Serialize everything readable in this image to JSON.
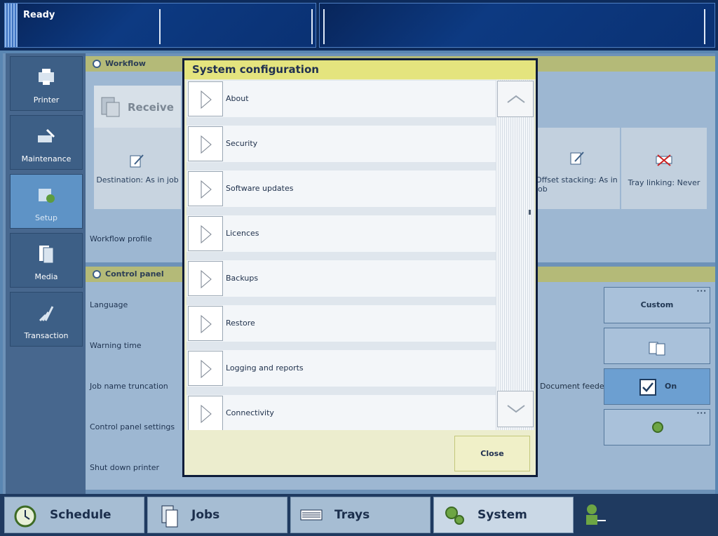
{
  "status": {
    "text": "Ready"
  },
  "nav": [
    {
      "label": "Printer",
      "icon": "printer-icon"
    },
    {
      "label": "Maintenance",
      "icon": "wrench-icon"
    },
    {
      "label": "Setup",
      "icon": "setup-icon"
    },
    {
      "label": "Media",
      "icon": "media-icon"
    },
    {
      "label": "Transaction",
      "icon": "transaction-icon"
    }
  ],
  "workflow": {
    "title": "Workflow",
    "receive_label": "Receive",
    "destination": "Destination: As in job",
    "offset": "Offset stacking: As in job",
    "tray_linking": "Tray linking: Never",
    "profile_label": "Workflow profile"
  },
  "control_panel": {
    "title": "Control panel",
    "rows": [
      "Language",
      "Warning time",
      "Job name truncation",
      "Control panel settings",
      "Shut down printer"
    ],
    "custom_label": "Custom",
    "feeder_label": "Document feeder",
    "on_label": "On"
  },
  "dialog": {
    "title": "System configuration",
    "items": [
      {
        "label": "About"
      },
      {
        "label": "Security"
      },
      {
        "label": "Software updates"
      },
      {
        "label": "Licences"
      },
      {
        "label": "Backups"
      },
      {
        "label": "Restore"
      },
      {
        "label": "Logging and reports"
      },
      {
        "label": "Connectivity"
      }
    ],
    "close_label": "Close"
  },
  "tabs": [
    {
      "label": "Schedule",
      "icon": "clock-icon"
    },
    {
      "label": "Jobs",
      "icon": "jobs-icon"
    },
    {
      "label": "Trays",
      "icon": "trays-icon"
    },
    {
      "label": "System",
      "icon": "gears-icon"
    }
  ],
  "colors": {
    "accent": "#e4e47e",
    "navy": "#0d1c3a",
    "active_tab": "#cad8e6"
  }
}
